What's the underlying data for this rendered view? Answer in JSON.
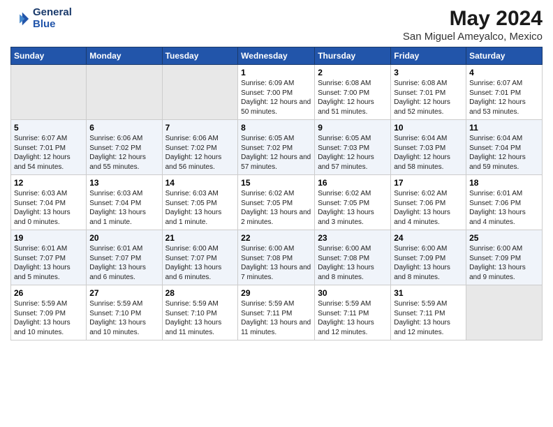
{
  "header": {
    "logo_line1": "General",
    "logo_line2": "Blue",
    "title": "May 2024",
    "subtitle": "San Miguel Ameyalco, Mexico"
  },
  "days_of_week": [
    "Sunday",
    "Monday",
    "Tuesday",
    "Wednesday",
    "Thursday",
    "Friday",
    "Saturday"
  ],
  "weeks": [
    [
      {
        "day": "",
        "info": ""
      },
      {
        "day": "",
        "info": ""
      },
      {
        "day": "",
        "info": ""
      },
      {
        "day": "1",
        "info": "Sunrise: 6:09 AM\nSunset: 7:00 PM\nDaylight: 12 hours\nand 50 minutes."
      },
      {
        "day": "2",
        "info": "Sunrise: 6:08 AM\nSunset: 7:00 PM\nDaylight: 12 hours\nand 51 minutes."
      },
      {
        "day": "3",
        "info": "Sunrise: 6:08 AM\nSunset: 7:01 PM\nDaylight: 12 hours\nand 52 minutes."
      },
      {
        "day": "4",
        "info": "Sunrise: 6:07 AM\nSunset: 7:01 PM\nDaylight: 12 hours\nand 53 minutes."
      }
    ],
    [
      {
        "day": "5",
        "info": "Sunrise: 6:07 AM\nSunset: 7:01 PM\nDaylight: 12 hours\nand 54 minutes."
      },
      {
        "day": "6",
        "info": "Sunrise: 6:06 AM\nSunset: 7:02 PM\nDaylight: 12 hours\nand 55 minutes."
      },
      {
        "day": "7",
        "info": "Sunrise: 6:06 AM\nSunset: 7:02 PM\nDaylight: 12 hours\nand 56 minutes."
      },
      {
        "day": "8",
        "info": "Sunrise: 6:05 AM\nSunset: 7:02 PM\nDaylight: 12 hours\nand 57 minutes."
      },
      {
        "day": "9",
        "info": "Sunrise: 6:05 AM\nSunset: 7:03 PM\nDaylight: 12 hours\nand 57 minutes."
      },
      {
        "day": "10",
        "info": "Sunrise: 6:04 AM\nSunset: 7:03 PM\nDaylight: 12 hours\nand 58 minutes."
      },
      {
        "day": "11",
        "info": "Sunrise: 6:04 AM\nSunset: 7:04 PM\nDaylight: 12 hours\nand 59 minutes."
      }
    ],
    [
      {
        "day": "12",
        "info": "Sunrise: 6:03 AM\nSunset: 7:04 PM\nDaylight: 13 hours\nand 0 minutes."
      },
      {
        "day": "13",
        "info": "Sunrise: 6:03 AM\nSunset: 7:04 PM\nDaylight: 13 hours\nand 1 minute."
      },
      {
        "day": "14",
        "info": "Sunrise: 6:03 AM\nSunset: 7:05 PM\nDaylight: 13 hours\nand 1 minute."
      },
      {
        "day": "15",
        "info": "Sunrise: 6:02 AM\nSunset: 7:05 PM\nDaylight: 13 hours\nand 2 minutes."
      },
      {
        "day": "16",
        "info": "Sunrise: 6:02 AM\nSunset: 7:05 PM\nDaylight: 13 hours\nand 3 minutes."
      },
      {
        "day": "17",
        "info": "Sunrise: 6:02 AM\nSunset: 7:06 PM\nDaylight: 13 hours\nand 4 minutes."
      },
      {
        "day": "18",
        "info": "Sunrise: 6:01 AM\nSunset: 7:06 PM\nDaylight: 13 hours\nand 4 minutes."
      }
    ],
    [
      {
        "day": "19",
        "info": "Sunrise: 6:01 AM\nSunset: 7:07 PM\nDaylight: 13 hours\nand 5 minutes."
      },
      {
        "day": "20",
        "info": "Sunrise: 6:01 AM\nSunset: 7:07 PM\nDaylight: 13 hours\nand 6 minutes."
      },
      {
        "day": "21",
        "info": "Sunrise: 6:00 AM\nSunset: 7:07 PM\nDaylight: 13 hours\nand 6 minutes."
      },
      {
        "day": "22",
        "info": "Sunrise: 6:00 AM\nSunset: 7:08 PM\nDaylight: 13 hours\nand 7 minutes."
      },
      {
        "day": "23",
        "info": "Sunrise: 6:00 AM\nSunset: 7:08 PM\nDaylight: 13 hours\nand 8 minutes."
      },
      {
        "day": "24",
        "info": "Sunrise: 6:00 AM\nSunset: 7:09 PM\nDaylight: 13 hours\nand 8 minutes."
      },
      {
        "day": "25",
        "info": "Sunrise: 6:00 AM\nSunset: 7:09 PM\nDaylight: 13 hours\nand 9 minutes."
      }
    ],
    [
      {
        "day": "26",
        "info": "Sunrise: 5:59 AM\nSunset: 7:09 PM\nDaylight: 13 hours\nand 10 minutes."
      },
      {
        "day": "27",
        "info": "Sunrise: 5:59 AM\nSunset: 7:10 PM\nDaylight: 13 hours\nand 10 minutes."
      },
      {
        "day": "28",
        "info": "Sunrise: 5:59 AM\nSunset: 7:10 PM\nDaylight: 13 hours\nand 11 minutes."
      },
      {
        "day": "29",
        "info": "Sunrise: 5:59 AM\nSunset: 7:11 PM\nDaylight: 13 hours\nand 11 minutes."
      },
      {
        "day": "30",
        "info": "Sunrise: 5:59 AM\nSunset: 7:11 PM\nDaylight: 13 hours\nand 12 minutes."
      },
      {
        "day": "31",
        "info": "Sunrise: 5:59 AM\nSunset: 7:11 PM\nDaylight: 13 hours\nand 12 minutes."
      },
      {
        "day": "",
        "info": ""
      }
    ]
  ]
}
